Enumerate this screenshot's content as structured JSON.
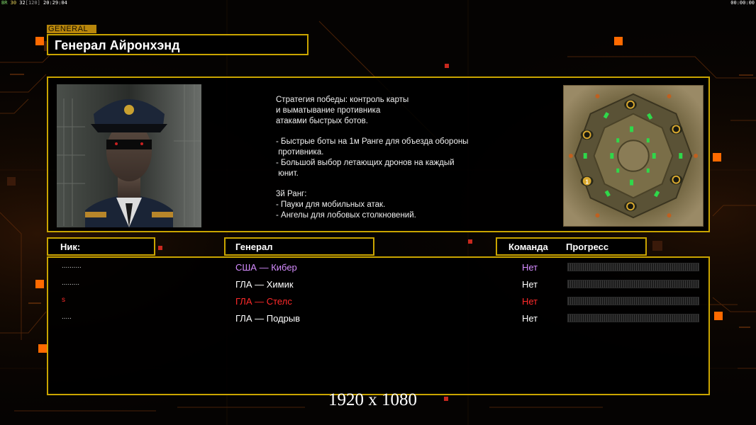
{
  "hud": {
    "left_parts": [
      {
        "text": "BR",
        "tone": "g"
      },
      {
        "text": " 30 ",
        "tone": "y"
      },
      {
        "text": "32",
        "tone": "w"
      },
      {
        "text": "[120]",
        "tone": "dim"
      },
      {
        "text": " 20:29:04",
        "tone": "w"
      }
    ],
    "right": "00:00:00"
  },
  "general_tag": "GENERAL",
  "general_title": "Генерал Айронхэнд",
  "strategy_text": "Стратегия победы: контроль карты\nи выматывание противника\nатаками быстрых ботов.\n\n- Быстрые боты на 1м Ранге для объезда обороны\n противника.\n- Большой выбор летающих дронов на каждый\n юнит.\n\n3й Ранг:\n- Пауки для мобильных атак.\n- Ангелы для лобовых столкновений.",
  "headers": {
    "nick": "Ник:",
    "general": "Генерал",
    "team": "Команда",
    "progress": "Прогресс"
  },
  "players": [
    {
      "nick": "..........",
      "general": "США — Кибер",
      "team": "Нет",
      "color": "#d68cff",
      "nick_color": "#cfcfcf",
      "progress": 0
    },
    {
      "nick": ".........",
      "general": "ГЛА — Химик",
      "team": "Нет",
      "color": "#ffffff",
      "nick_color": "#cfcfcf",
      "progress": 0
    },
    {
      "nick": "s",
      "general": "ГЛА — Стелс",
      "team": "Нет",
      "color": "#ff2a2a",
      "nick_color": "#ff2a2a",
      "progress": 0
    },
    {
      "nick": ".....",
      "general": "ГЛА — Подрыв",
      "team": "Нет",
      "color": "#ffffff",
      "nick_color": "#cfcfcf",
      "progress": 0
    }
  ],
  "minimap_marker": "1",
  "resolution": "1920 x 1080",
  "colors": {
    "accent": "#c9a400",
    "glow": "#ff6a00"
  }
}
